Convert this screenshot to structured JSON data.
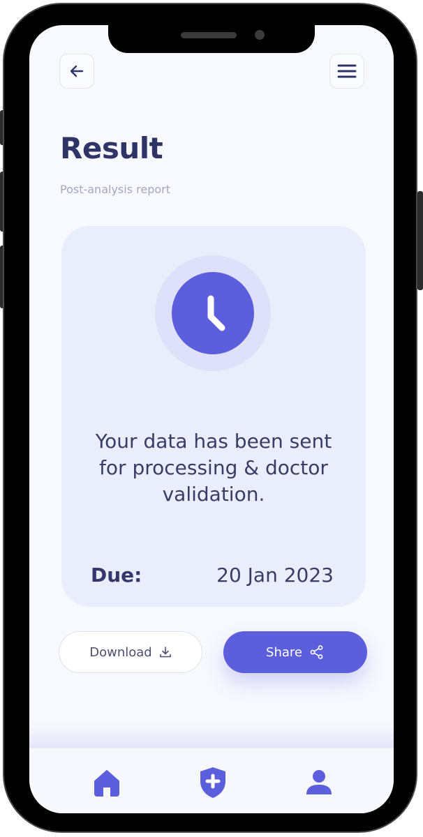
{
  "header": {
    "back_icon": "arrow-left-icon",
    "menu_icon": "hamburger-menu-icon"
  },
  "page": {
    "title": "Result",
    "subtitle": "Post-analysis report"
  },
  "card": {
    "status_icon": "clock-icon",
    "message": "Your data has been sent for processing & doctor validation.",
    "due_label": "Due:",
    "due_value": "20 Jan 2023"
  },
  "actions": {
    "download_label": "Download",
    "download_icon": "download-icon",
    "share_label": "Share",
    "share_icon": "share-icon"
  },
  "nav": {
    "items": [
      {
        "icon": "home-icon"
      },
      {
        "icon": "shield-plus-icon"
      },
      {
        "icon": "user-icon"
      }
    ]
  },
  "colors": {
    "accent": "#5b5fdc",
    "heading": "#2f3466",
    "card_bg": "#eaedfc",
    "screen_bg": "#f8f9fe"
  }
}
